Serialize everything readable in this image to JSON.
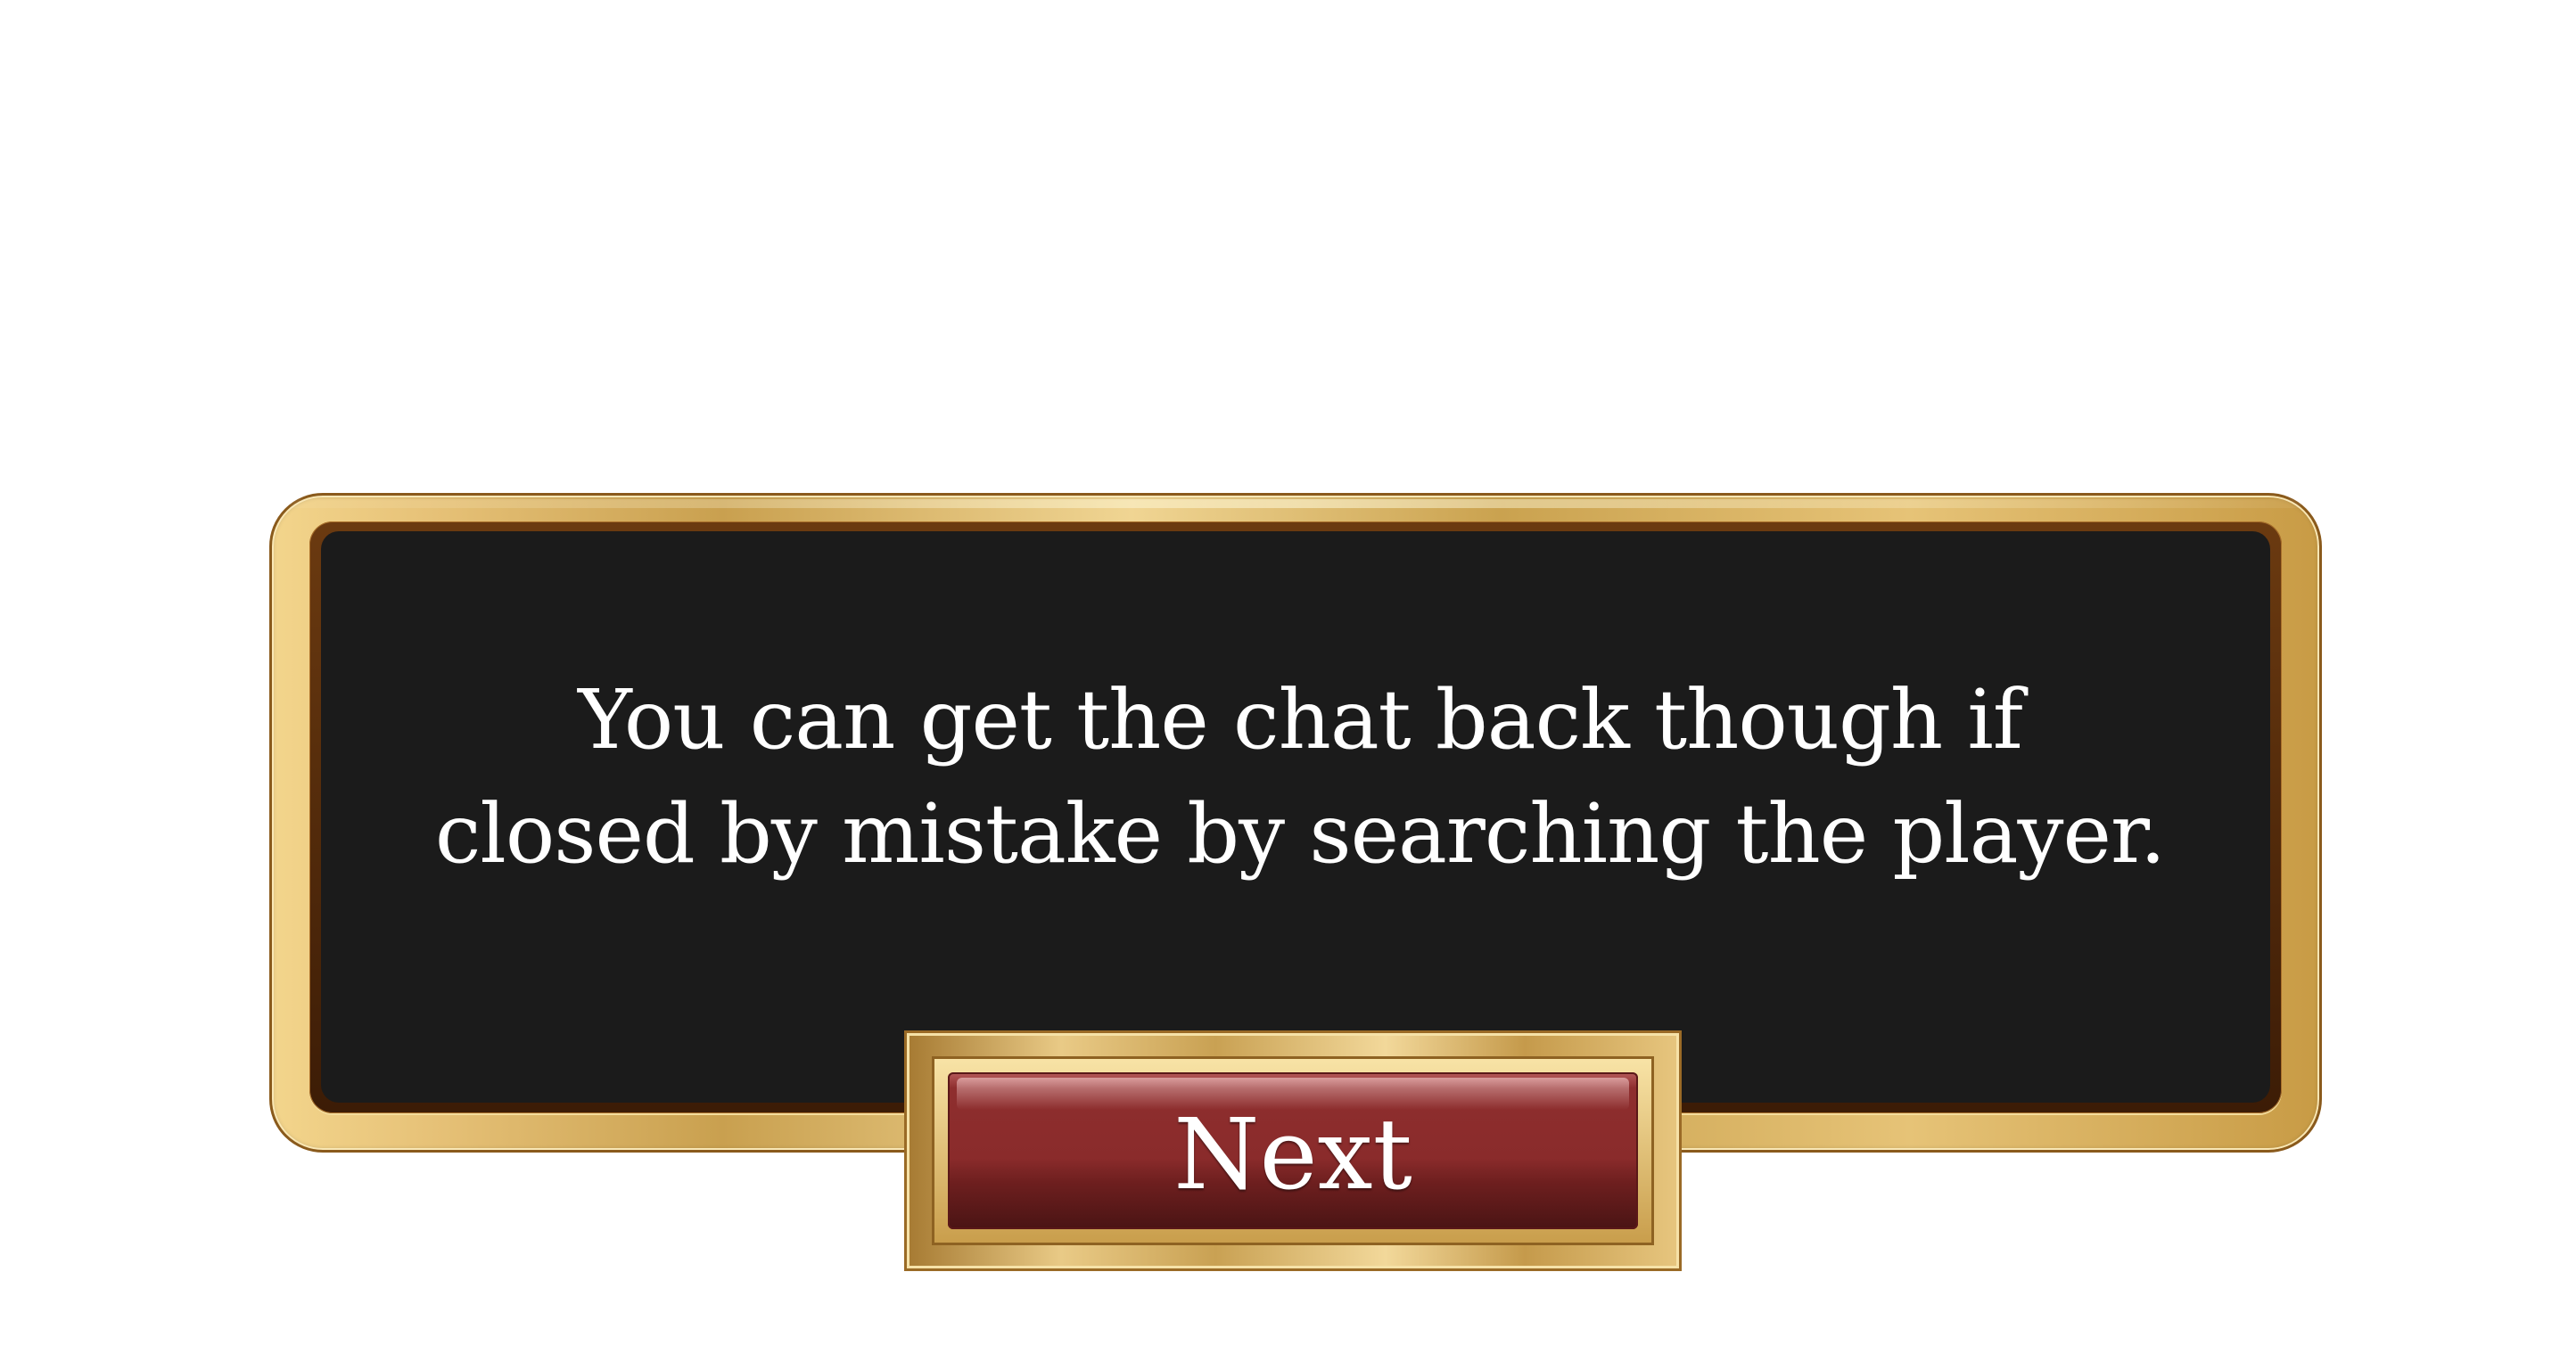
{
  "dialog": {
    "message_line1": "You can get the chat back though if",
    "message_line2": "closed by mistake by searching the player."
  },
  "buttons": {
    "next_label": "Next"
  },
  "colors": {
    "panel_background": "#1b1b1b",
    "gold_frame": "#e6c177",
    "button_red": "#8a2b2b",
    "text": "#ffffff"
  }
}
